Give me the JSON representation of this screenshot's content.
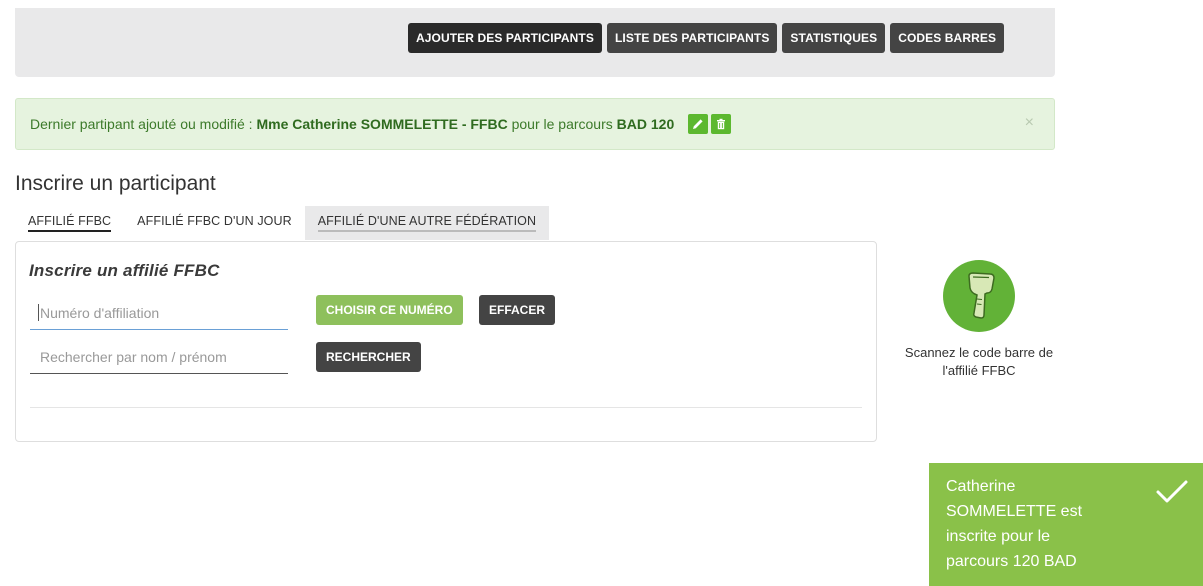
{
  "nav": {
    "items": [
      {
        "label": "AJOUTER DES PARTICIPANTS",
        "active": true
      },
      {
        "label": "LISTE DES PARTICIPANTS"
      },
      {
        "label": "STATISTIQUES"
      },
      {
        "label": "CODES BARRES"
      }
    ]
  },
  "alert": {
    "prefix": "Dernier partipant ajouté ou modifié : ",
    "participant": "Mme Catherine SOMMELETTE - FFBC",
    "middle": " pour le parcours ",
    "course": "BAD 120",
    "close": "×",
    "edit_icon": "pencil-icon",
    "delete_icon": "trash-icon"
  },
  "section_title": "Inscrire un participant",
  "tabs": [
    {
      "label": "AFFILIÉ FFBC",
      "active": true
    },
    {
      "label": "AFFILIÉ FFBC D'UN JOUR"
    },
    {
      "label": "AFFILIÉ D'UNE AUTRE FÉDÉRATION"
    }
  ],
  "card": {
    "title": "Inscrire un affilié FFBC",
    "affiliation_placeholder": "Numéro d'affiliation",
    "choose_label": "CHOISIR CE NUMÉRO",
    "clear_label": "EFFACER",
    "search_placeholder": "Rechercher par nom / prénom",
    "search_label": "RECHERCHER"
  },
  "scanner": {
    "icon": "barcode-scanner-icon",
    "text": "Scannez le code barre de l'affilié FFBC"
  },
  "toast": {
    "message": "Catherine SOMMELETTE est inscrite pour le parcours 120 BAD",
    "icon": "check-icon"
  },
  "colors": {
    "accent_green": "#62b237",
    "toast_green": "#8ac149",
    "dark_button": "#444444",
    "alert_bg": "#e6f3df"
  }
}
